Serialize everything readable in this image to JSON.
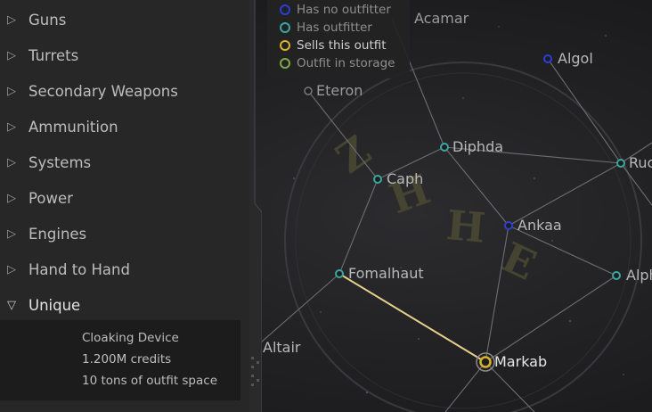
{
  "colors": {
    "no_outfitter": "#2a3fd6",
    "has_outfitter": "#3aa6a0",
    "sells_outfit": "#d9b32a",
    "in_storage": "#7fa84a",
    "route": "#e7d08a"
  },
  "legend": {
    "items": [
      {
        "label": "Has no outfitter",
        "color": "#2a3fd6",
        "highlight": false
      },
      {
        "label": "Has outfitter",
        "color": "#3aa6a0",
        "highlight": false
      },
      {
        "label": "Sells this outfit",
        "color": "#d9b32a",
        "highlight": true
      },
      {
        "label": "Outfit in storage",
        "color": "#7fa84a",
        "highlight": false
      }
    ]
  },
  "sidebar": {
    "categories": [
      {
        "label": "Guns",
        "arrow": "▷",
        "open": false
      },
      {
        "label": "Turrets",
        "arrow": "▷",
        "open": false
      },
      {
        "label": "Secondary Weapons",
        "arrow": "▷",
        "open": false
      },
      {
        "label": "Ammunition",
        "arrow": "▷",
        "open": false
      },
      {
        "label": "Systems",
        "arrow": "▷",
        "open": false
      },
      {
        "label": "Power",
        "arrow": "▷",
        "open": false
      },
      {
        "label": "Engines",
        "arrow": "▷",
        "open": false
      },
      {
        "label": "Hand to Hand",
        "arrow": "▷",
        "open": false
      },
      {
        "label": "Unique",
        "arrow": "▽",
        "open": true
      }
    ],
    "selected_item": {
      "name": "Cloaking Device",
      "cost": "1.200M credits",
      "space": "10 tons of outfit space"
    }
  },
  "map": {
    "systems": [
      {
        "name": "Acamar",
        "kind": "none"
      },
      {
        "name": "Algol",
        "kind": "no_outfitter"
      },
      {
        "name": "Eteron",
        "kind": "none"
      },
      {
        "name": "Diphda",
        "kind": "has_outfitter"
      },
      {
        "name": "Ruchbah",
        "label": "Ruc",
        "kind": "has_outfitter"
      },
      {
        "name": "Caph",
        "kind": "has_outfitter"
      },
      {
        "name": "Ankaa",
        "kind": "no_outfitter"
      },
      {
        "name": "Fomalhaut",
        "kind": "has_outfitter"
      },
      {
        "name": "Alpheratz",
        "label": "Alph",
        "kind": "has_outfitter"
      },
      {
        "name": "Altair",
        "kind": "no_outfitter"
      },
      {
        "name": "Markab",
        "kind": "sells_outfit"
      }
    ],
    "route": [
      "Fomalhaut",
      "Markab"
    ],
    "territory_glyphs": "ZHHE"
  }
}
